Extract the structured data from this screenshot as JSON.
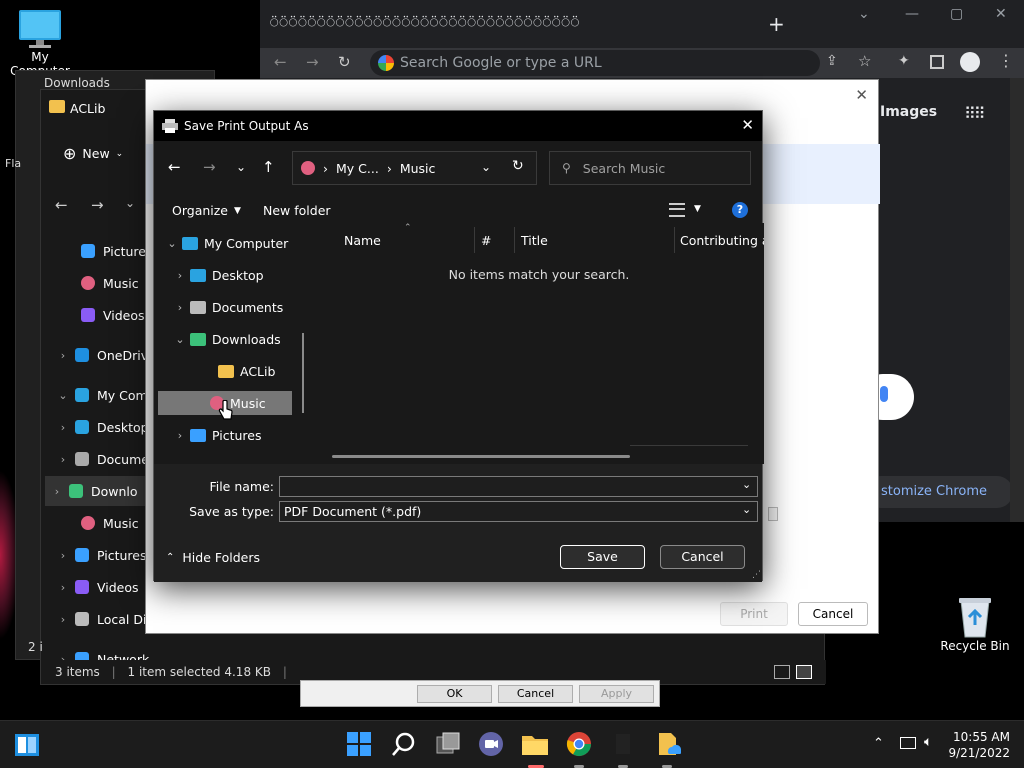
{
  "desktop": {
    "my_computer_label": "My Computer",
    "recycle_bin_label": "Recycle Bin"
  },
  "chrome": {
    "tab_title": "⍥⍥⍥⍥⍥⍥⍥⍥⍥⍥⍥⍥⍥⍥⍥⍥⍥⍥⍥⍥⍥⍥⍥⍥⍥⍥⍥⍥⍥⍥⍥⍥⍥",
    "omnibox_placeholder": "Search Google or type a URL",
    "images_link": "Images",
    "customize_label": "stomize Chrome"
  },
  "downloads_window": {
    "title": "Downloads",
    "folder": "ACLib",
    "partial": "Fla"
  },
  "explorer": {
    "new_label": "New",
    "sidebar": [
      {
        "label": "Pictures",
        "icon": "pictures-icon"
      },
      {
        "label": "Music",
        "icon": "music-icon"
      },
      {
        "label": "Videos",
        "icon": "videos-icon"
      },
      {
        "label": "OneDrive",
        "icon": "onedrive-icon"
      },
      {
        "label": "My Comp",
        "icon": "computer-icon"
      },
      {
        "label": "Desktop",
        "icon": "desktop-icon"
      },
      {
        "label": "Docume",
        "icon": "documents-icon"
      },
      {
        "label": "Downlo",
        "icon": "download-icon"
      },
      {
        "label": "Music",
        "icon": "music-icon"
      },
      {
        "label": "Pictures",
        "icon": "pictures-icon"
      },
      {
        "label": "Videos",
        "icon": "videos-icon"
      },
      {
        "label": "Local Dis",
        "icon": "drive-icon"
      },
      {
        "label": "Network",
        "icon": "network-icon"
      }
    ],
    "status_items": "3 items",
    "status_selected": "1 item selected  4.18 KB",
    "status_left_partial": "2 i"
  },
  "print_dialog": {
    "print_label": "Print",
    "cancel_label": "Cancel"
  },
  "behind_dialog": {
    "ok_label": "OK",
    "cancel_label": "Cancel",
    "apply_label": "Apply"
  },
  "save_dialog": {
    "title": "Save Print Output As",
    "path_parts": [
      "My C...",
      "Music"
    ],
    "search_placeholder": "Search Music",
    "organize_label": "Organize",
    "new_folder_label": "New folder",
    "tree": [
      {
        "label": "My Computer",
        "icon": "computer-icon",
        "expanded": true
      },
      {
        "label": "Desktop",
        "icon": "desktop-icon"
      },
      {
        "label": "Documents",
        "icon": "documents-icon"
      },
      {
        "label": "Downloads",
        "icon": "download-icon",
        "expanded": true
      },
      {
        "label": "ACLib",
        "icon": "folder-icon"
      },
      {
        "label": "Music",
        "icon": "music-icon",
        "selected": true
      },
      {
        "label": "Pictures",
        "icon": "pictures-icon"
      }
    ],
    "columns": [
      "Name",
      "#",
      "Title",
      "Contributing art"
    ],
    "empty_message": "No items match your search.",
    "file_name_label": "File name:",
    "file_name_value": "",
    "save_as_type_label": "Save as type:",
    "save_as_type_value": "PDF Document (*.pdf)",
    "hide_folders_label": "Hide Folders",
    "save_label": "Save",
    "cancel_label": "Cancel"
  },
  "taskbar": {
    "time": "10:55 AM",
    "date": "9/21/2022"
  }
}
